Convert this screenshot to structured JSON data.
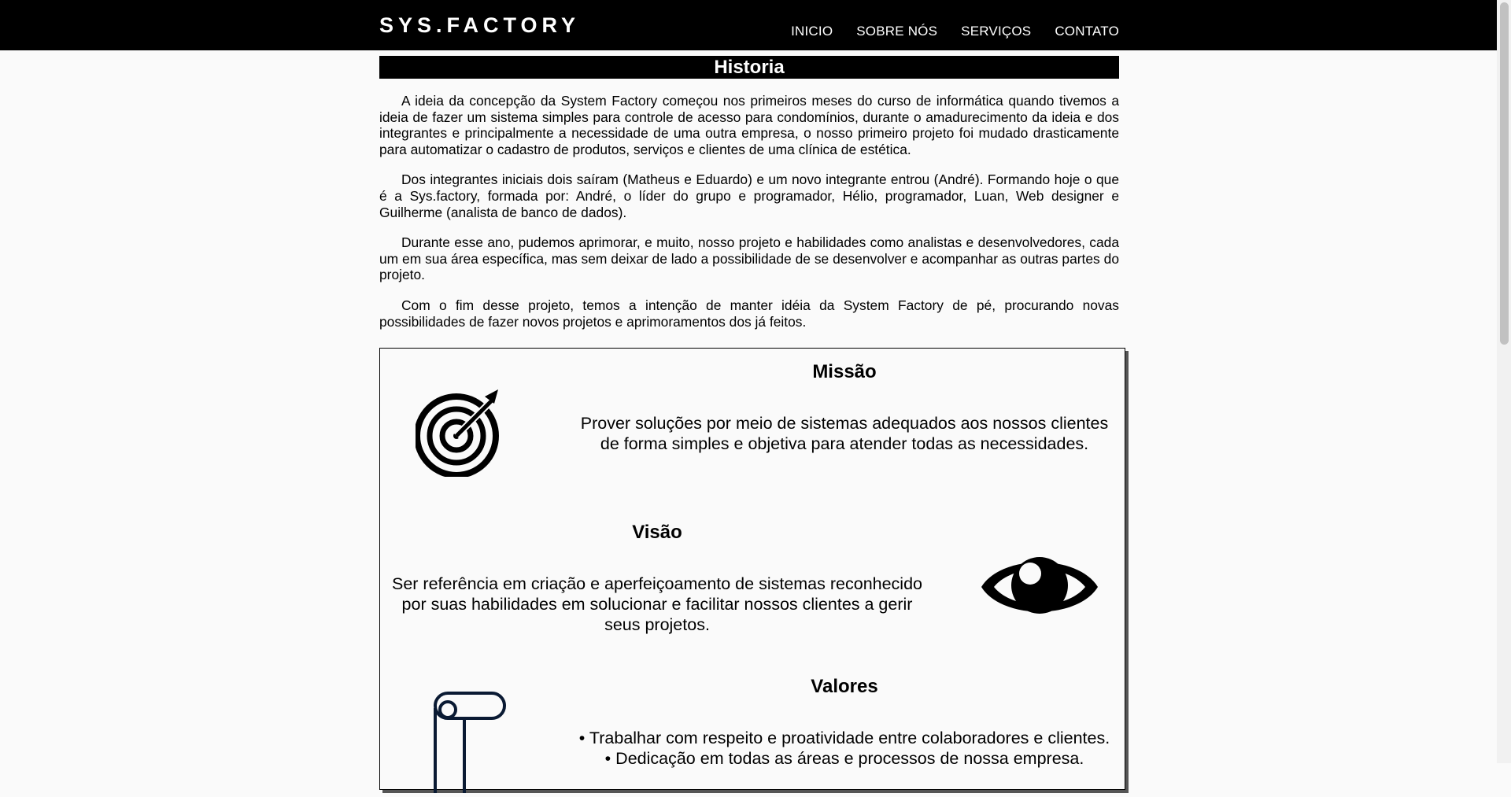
{
  "header": {
    "brand": "SYS.FACTORY",
    "nav": [
      "INICIO",
      "SOBRE NÓS",
      "SERVIÇOS",
      "CONTATO"
    ]
  },
  "history": {
    "title": "Historia",
    "paragraphs": [
      "A ideia da concepção da System Factory começou nos primeiros meses do curso de informática quando tivemos a ideia de fazer um sistema simples para controle de acesso para condomínios, durante o amadurecimento da ideia e dos integrantes e principalmente a necessidade de uma outra empresa, o nosso primeiro projeto foi mudado drasticamente para automatizar o cadastro de produtos, serviços e clientes de uma clínica de estética.",
      "Dos integrantes iniciais dois saíram (Matheus e Eduardo) e um novo integrante entrou (André). Formando hoje o que é a Sys.factory, formada por: André, o líder do grupo e programador, Hélio, programador, Luan, Web designer e Guilherme (analista de banco de dados).",
      "Durante esse ano, pudemos aprimorar, e muito, nosso projeto e habilidades como analistas e desenvolvedores, cada um em sua área específica, mas sem deixar de lado a possibilidade de se desenvolver e acompanhar as outras partes do projeto.",
      "Com o fim desse projeto, temos a intenção de manter idéia da System Factory de pé, procurando novas possibilidades de fazer novos projetos e aprimoramentos dos já feitos."
    ]
  },
  "mission": {
    "title": "Missão",
    "text": "Prover soluções por meio de sistemas adequados aos nossos clientes de forma simples e objetiva para atender todas as necessidades.",
    "icon": "target-icon"
  },
  "vision": {
    "title": "Visão",
    "text": "Ser referência em criação e aperfeiçoamento de sistemas reconhecido por suas habilidades em solucionar e facilitar nossos clientes a gerir seus projetos.",
    "icon": "eye-icon"
  },
  "values": {
    "title": "Valores",
    "items": [
      "• Trabalhar com respeito e proatividade entre colaboradores e clientes.",
      "• Dedicação em todas as áreas e processos de nossa empresa."
    ],
    "icon": "scroll-icon"
  }
}
